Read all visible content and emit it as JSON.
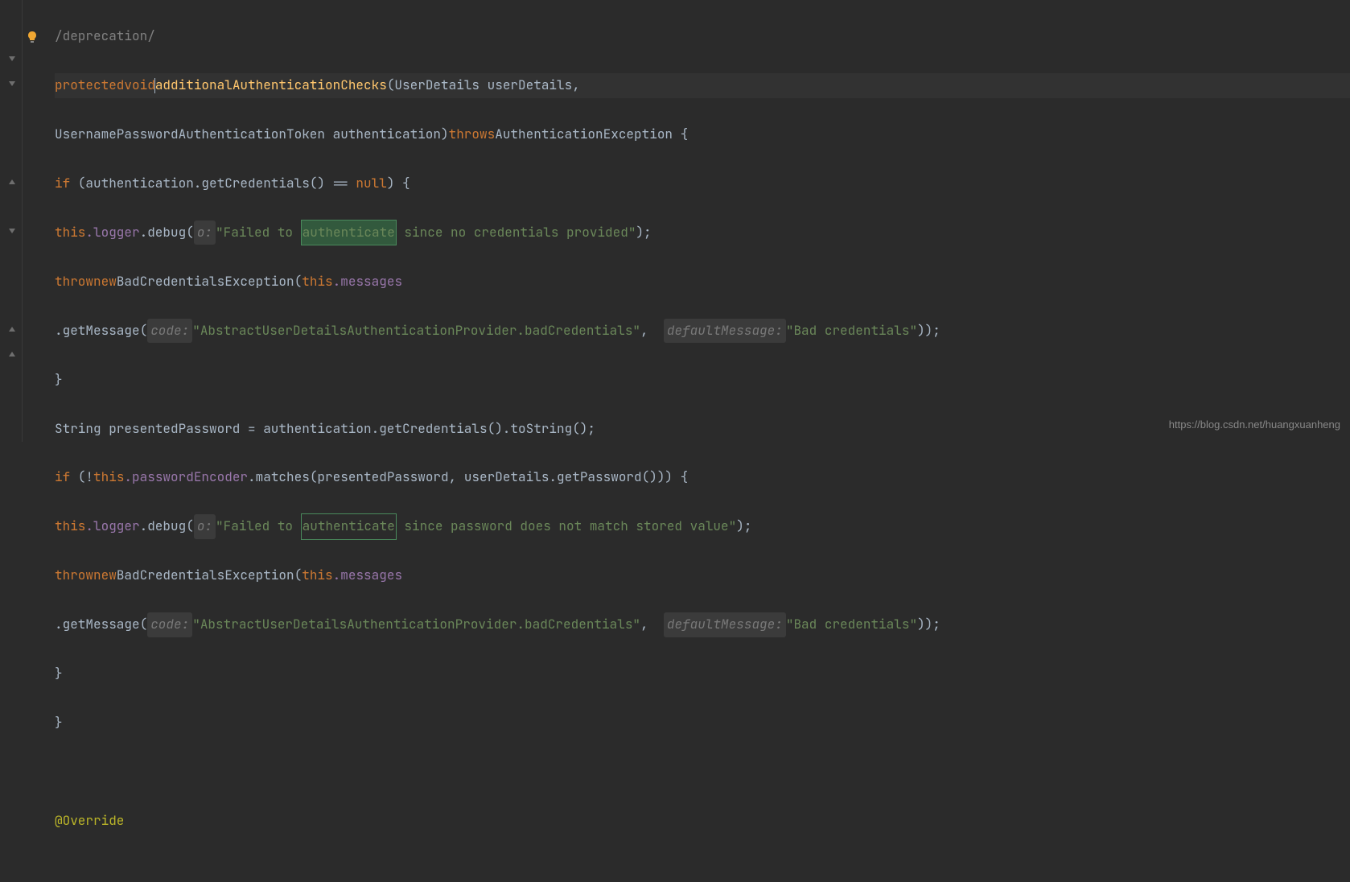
{
  "gutter": {
    "bulb_icon": "lightbulb-icon"
  },
  "code": {
    "l0_comment": "/deprecation/",
    "l1_protected": "protected",
    "l1_void": "void",
    "l1_method": "additionalAuthenticationChecks",
    "l1_params": "(UserDetails userDetails,",
    "l2_params": "UsernamePasswordAuthenticationToken authentication)",
    "l2_throws": "throws",
    "l2_exc": "AuthenticationException {",
    "l3_if": "if",
    "l3_cond1": " (authentication.getCredentials() == ",
    "l3_null": "null",
    "l3_cond2": ") {",
    "l4_this": "this",
    "l4_logger": ".logger",
    "l4_debug": ".debug(",
    "l4_hint": "o:",
    "l4_str1": "\"Failed to ",
    "l4_hl": "authenticate",
    "l4_str2": " since no credentials provided\"",
    "l4_end": ");",
    "l5_throw": "throw",
    "l5_new": "new",
    "l5_exc": "BadCredentialsException(",
    "l5_this": "this",
    "l5_msg": ".messages",
    "l6_getmsg": ".getMessage(",
    "l6_hint1": "code:",
    "l6_str1": "\"AbstractUserDetailsAuthenticationProvider.badCredentials\"",
    "l6_comma": ",  ",
    "l6_hint2": "defaultMessage:",
    "l6_str2": "\"Bad credentials\"",
    "l6_end": "));",
    "l7_brace": "}",
    "l8_string": "String presentedPassword = authentication.getCredentials().toString();",
    "l9_if": "if",
    "l9_cond1": " (!",
    "l9_this": "this",
    "l9_pe": ".passwordEncoder",
    "l9_cond2": ".matches(presentedPassword, userDetails.getPassword())) {",
    "l10_this": "this",
    "l10_logger": ".logger",
    "l10_debug": ".debug(",
    "l10_hint": "o:",
    "l10_str1": "\"Failed to ",
    "l10_hl": "authenticate",
    "l10_str2": " since password does not match stored value\"",
    "l10_end": ");",
    "l11_throw": "throw",
    "l11_new": "new",
    "l11_exc": "BadCredentialsException(",
    "l11_this": "this",
    "l11_msg": ".messages",
    "l12_getmsg": ".getMessage(",
    "l12_hint1": "code:",
    "l12_str1": "\"AbstractUserDetailsAuthenticationProvider.badCredentials\"",
    "l12_comma": ",  ",
    "l12_hint2": "defaultMessage:",
    "l12_str2": "\"Bad credentials\"",
    "l12_end": "));",
    "l13_brace": "}",
    "l14_brace": "}",
    "l16_annotation": "@Override"
  },
  "watermark": "https://blog.csdn.net/huangxuanheng"
}
